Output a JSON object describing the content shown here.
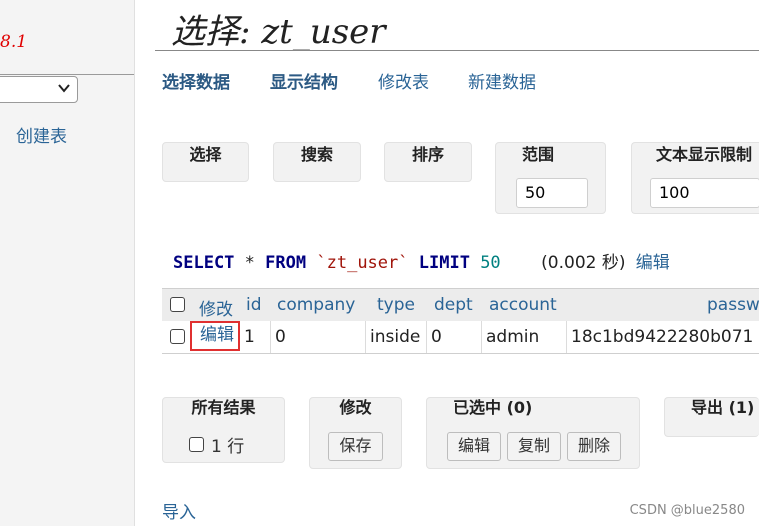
{
  "sidebar": {
    "version": "8.1",
    "create_table": "创建表"
  },
  "page": {
    "title": "选择: zt_user"
  },
  "nav": {
    "select_data": "选择数据",
    "show_structure": "显示结构",
    "alter_table": "修改表",
    "new_item": "新建数据"
  },
  "controls": {
    "select": "选择",
    "search": "搜索",
    "sort": "排序",
    "limit_label": "范围",
    "limit_value": "50",
    "text_length_label": "文本显示限制",
    "text_length_value": "100"
  },
  "query": {
    "select_kw": "SELECT",
    "star": "*",
    "from_kw": "FROM",
    "table": "`zt_user`",
    "limit_kw": "LIMIT",
    "limit": "50",
    "time": "(0.002 秒)",
    "edit": "编辑"
  },
  "table": {
    "header_modify": "修改",
    "columns": [
      "id",
      "company",
      "type",
      "dept",
      "account",
      "passw"
    ],
    "rows": [
      {
        "edit": "编辑",
        "id": "1",
        "company": "0",
        "type": "inside",
        "dept": "0",
        "account": "admin",
        "password": "18c1bd9422280b071"
      }
    ]
  },
  "actions": {
    "all_results": "所有结果",
    "row_count": "1 行",
    "modify": "修改",
    "save": "保存",
    "selected": "已选中 (0)",
    "edit": "编辑",
    "clone": "复制",
    "delete": "删除",
    "export": "导出 (1)"
  },
  "footer": {
    "import": "导入",
    "watermark": "CSDN @blue2580"
  }
}
